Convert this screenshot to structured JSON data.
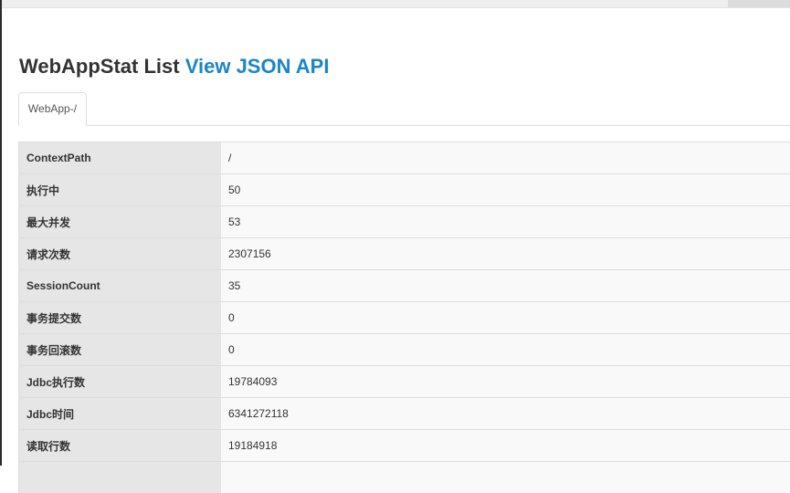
{
  "page": {
    "title_text": "WebAppStat List",
    "api_link": "View JSON API"
  },
  "tabs": [
    {
      "label": "WebApp-/"
    }
  ],
  "rows": [
    {
      "key": "ContextPath",
      "value": "/"
    },
    {
      "key": "执行中",
      "value": "50"
    },
    {
      "key": "最大并发",
      "value": "53"
    },
    {
      "key": "请求次数",
      "value": "2307156"
    },
    {
      "key": "SessionCount",
      "value": "35"
    },
    {
      "key": "事务提交数",
      "value": "0"
    },
    {
      "key": "事务回滚数",
      "value": "0"
    },
    {
      "key": "Jdbc执行数",
      "value": "19784093"
    },
    {
      "key": "Jdbc时间",
      "value": "6341272118"
    },
    {
      "key": "读取行数",
      "value": "19184918"
    },
    {
      "key": "",
      "value": ""
    }
  ],
  "colors": {
    "link": "#1a85c9",
    "key_cell_bg": "#e6e6e6",
    "value_cell_bg": "#f9f9f9"
  }
}
